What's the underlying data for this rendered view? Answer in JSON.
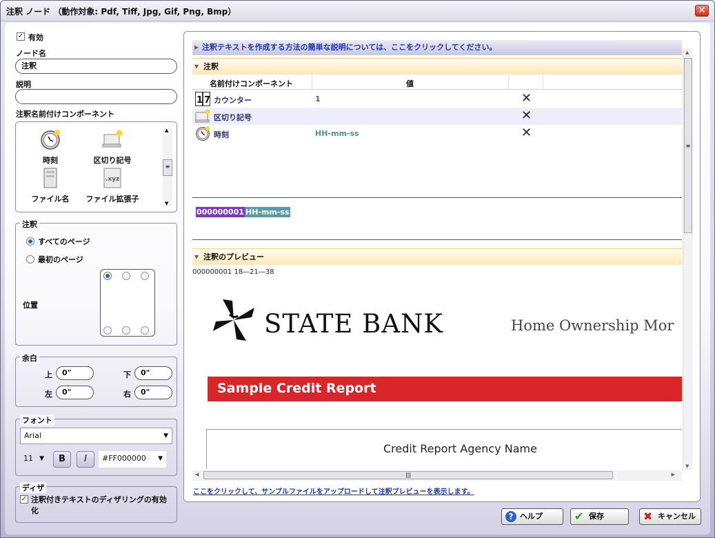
{
  "window": {
    "title": "注釈 ノード （動作対象: Pdf, Tiff, Jpg, Gif, Png, Bmp）",
    "close": "✕"
  },
  "left": {
    "enabled_label": "有効",
    "node_name_label": "ノード名",
    "node_name_value": "注釈",
    "description_label": "説明",
    "description_value": "",
    "components_label": "注釈名前付けコンポーネント",
    "components": [
      {
        "label": "時刻",
        "icon": "clock-icon"
      },
      {
        "label": "区切り記号",
        "icon": "separator-icon"
      },
      {
        "label": "ファイル名",
        "icon": "file-icon"
      },
      {
        "label": "ファイル拡張子",
        "icon": "file-extension-icon"
      }
    ],
    "annotation_group": "注釈",
    "all_pages": "すべてのページ",
    "first_page": "最初のページ",
    "position_label": "位置",
    "margin_group": "余白",
    "margin_top_label": "上",
    "margin_bottom_label": "下",
    "margin_left_label": "左",
    "margin_right_label": "右",
    "margin_top": "0\"",
    "margin_bottom": "0\"",
    "margin_left": "0\"",
    "margin_right": "0\"",
    "font_group": "フォント",
    "font_family": "Arial",
    "font_size": "11",
    "bold": "B",
    "italic": "I",
    "color": "#FF000000",
    "dither_group": "ディザ",
    "dither_label": "注釈付きテキストのディザリングの有効化"
  },
  "main": {
    "info_link": "注釈テキストを作成する方法の簡単な説明については、ここをクリックしてください。",
    "annotation_section": "注釈",
    "col_component": "名前付けコンポーネント",
    "col_value": "値",
    "rows": [
      {
        "name": "カウンター",
        "value": "1",
        "value_color": "#8a3cc7"
      },
      {
        "name": "区切り記号",
        "value": "",
        "value_color": "#000000"
      },
      {
        "name": "時刻",
        "value": "HH-mm-ss",
        "value_color": "#4f8f98"
      }
    ],
    "token_counter": "000000001",
    "token_time": "HH-mm-ss",
    "preview_section": "注釈のプレビュー",
    "preview_stamp": "000000001 18―21―38",
    "bank_name": "STATE BANK",
    "bank_subtitle": "Home Ownership Mor",
    "report_banner": "Sample Credit Report",
    "agency": "Credit Report Agency Name",
    "upload_link": "ここをクリックして、サンプルファイルをアップロードして注釈プレビューを表示します。"
  },
  "buttons": {
    "help": "ヘルプ",
    "save": "保存",
    "cancel": "キャンセル"
  },
  "colors": {
    "accent_link": "#1a38b8",
    "banner_red": "#d9262b",
    "token_purple": "#7a3bbf",
    "token_teal": "#5b9aa5"
  }
}
